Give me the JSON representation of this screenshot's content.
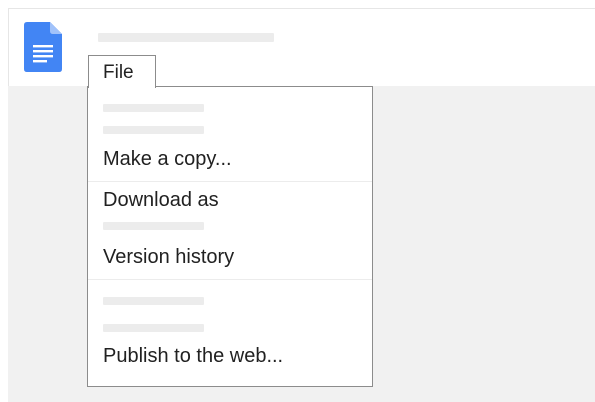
{
  "app": {
    "icon": "google-docs-document-icon",
    "accent_color": "#4285f4"
  },
  "menubar": {
    "file_label": "File"
  },
  "file_menu": {
    "items": [
      {
        "label": "Make a copy..."
      },
      {
        "label": "Download as"
      },
      {
        "label": "Version history"
      },
      {
        "label": "Publish to the web..."
      }
    ]
  }
}
